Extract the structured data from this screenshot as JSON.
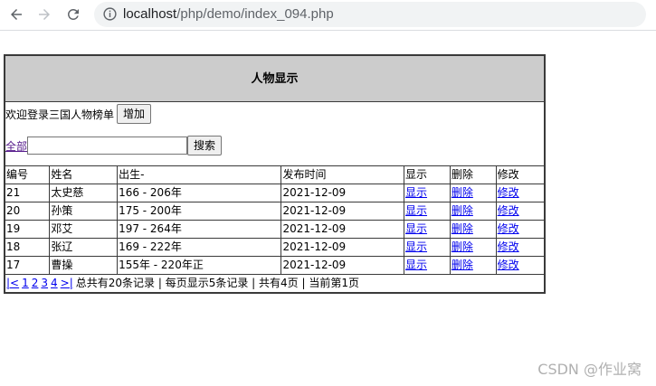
{
  "browser": {
    "url_host": "localhost",
    "url_path": "/php/demo/index_094.php"
  },
  "page": {
    "title": "人物显示",
    "welcome_text": "欢迎登录三国人物榜单",
    "add_button": "增加",
    "all_link": "全部",
    "search_value": "",
    "search_button": "搜索",
    "columns": [
      "编号",
      "姓名",
      "出生-",
      "发布时间",
      "显示",
      "删除",
      "修改"
    ],
    "rows": [
      {
        "id": "21",
        "name": "太史慈",
        "birth": "166 - 206年",
        "date": "2021-12-09",
        "show": "显示",
        "delete": "删除",
        "edit": "修改"
      },
      {
        "id": "20",
        "name": "孙策",
        "birth": "175 - 200年",
        "date": "2021-12-09",
        "show": "显示",
        "delete": "删除",
        "edit": "修改"
      },
      {
        "id": "19",
        "name": "邓艾",
        "birth": "197 - 264年",
        "date": "2021-12-09",
        "show": "显示",
        "delete": "删除",
        "edit": "修改"
      },
      {
        "id": "18",
        "name": "张辽",
        "birth": "169 - 222年",
        "date": "2021-12-09",
        "show": "显示",
        "delete": "删除",
        "edit": "修改"
      },
      {
        "id": "17",
        "name": "曹操",
        "birth": "155年 - 220年正",
        "date": "2021-12-09",
        "show": "显示",
        "delete": "删除",
        "edit": "修改"
      }
    ],
    "pager": {
      "first": "|<",
      "pages": [
        "1",
        "2",
        "3",
        "4"
      ],
      "last": ">|",
      "summary": "总共有20条记录 | 每页显示5条记录 | 共有4页 | 当前第1页"
    }
  },
  "watermark": "CSDN @作业窝"
}
